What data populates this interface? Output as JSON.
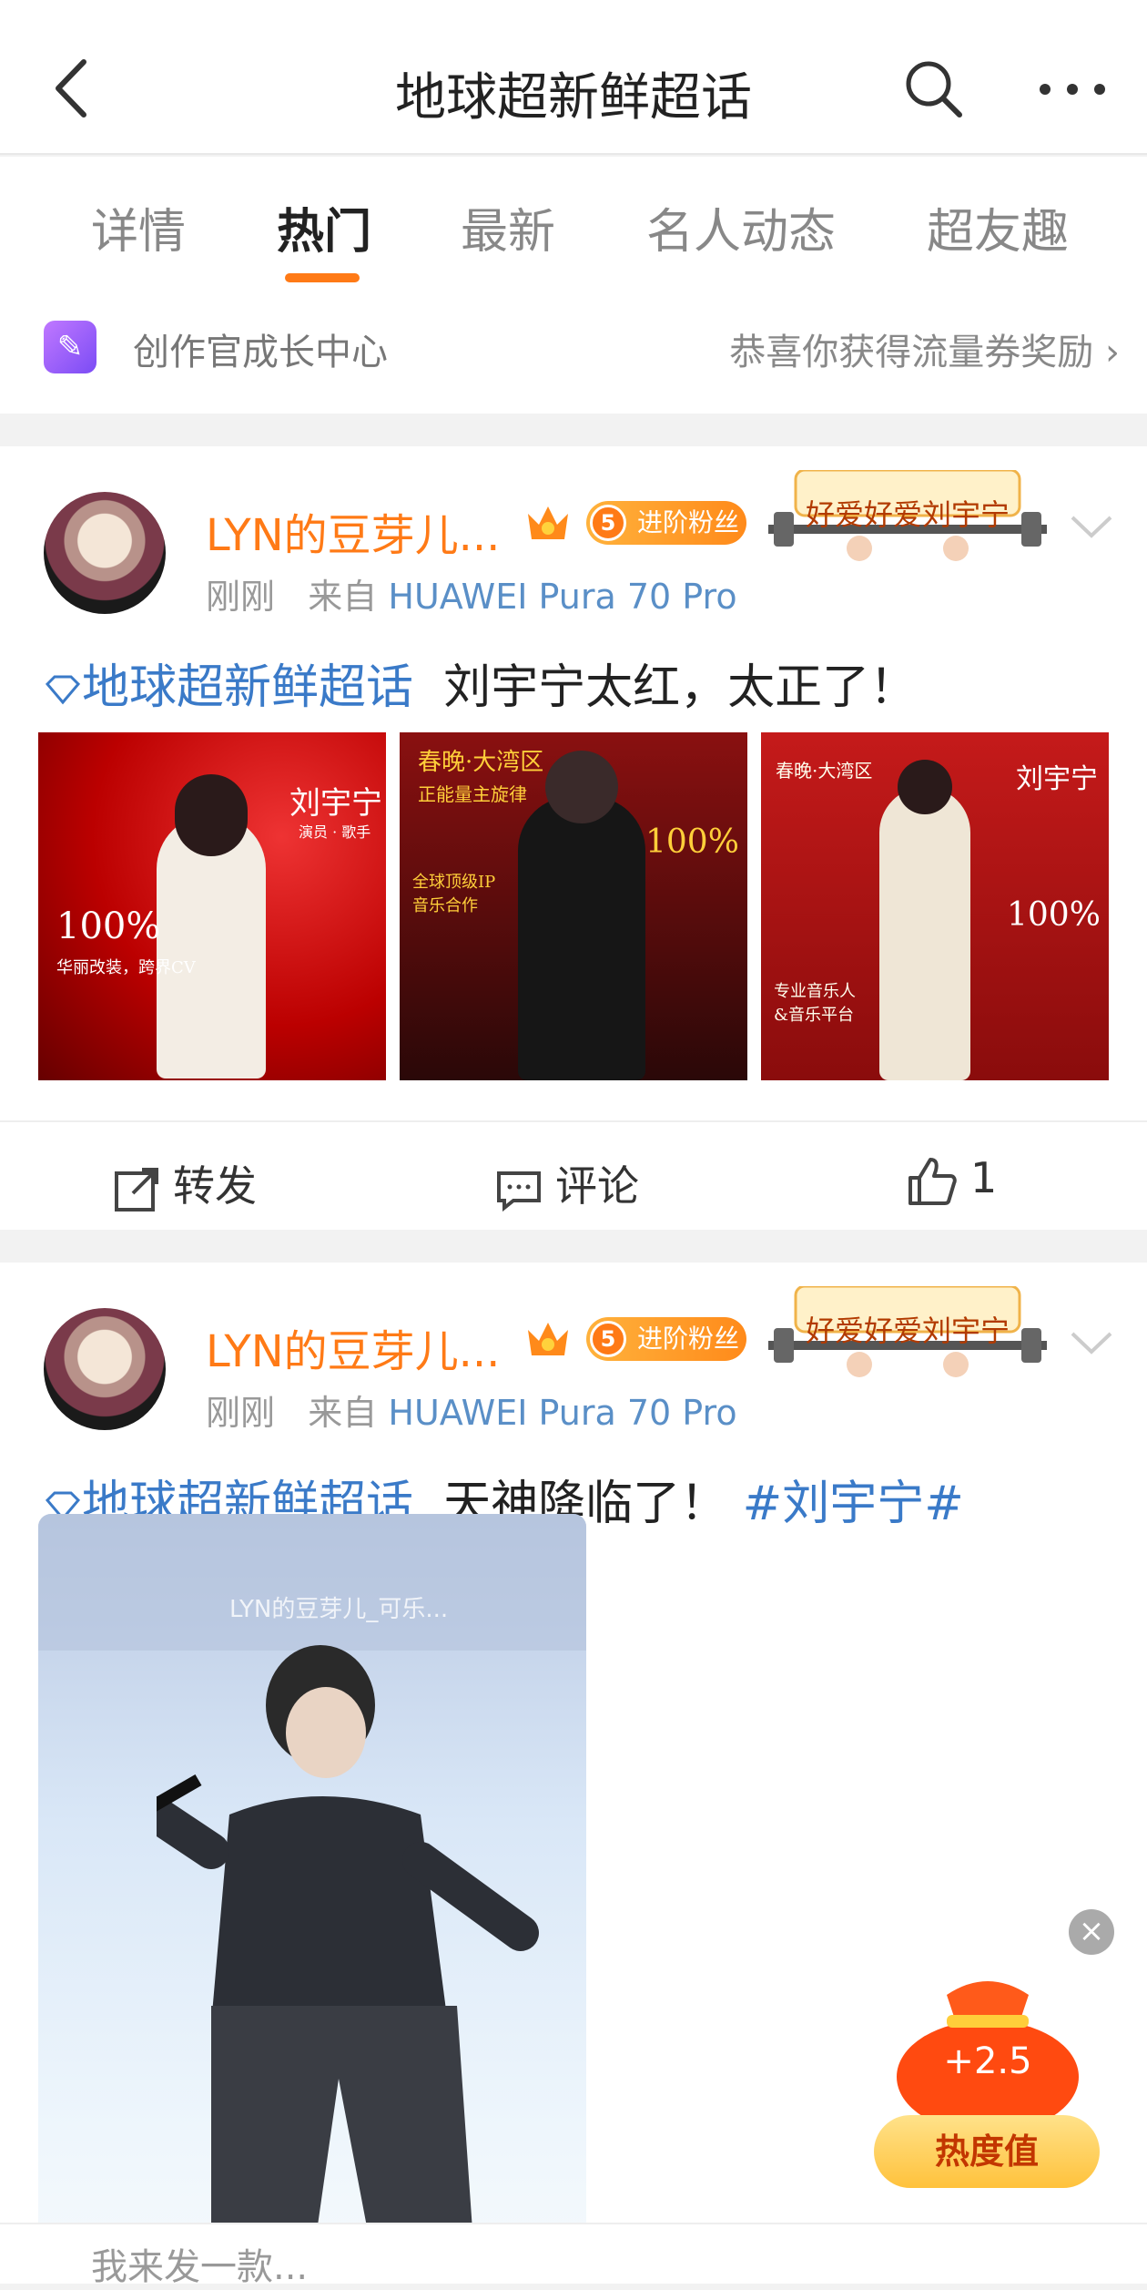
{
  "header": {
    "title": "地球超新鲜超话"
  },
  "tabs": [
    "详情",
    "热门",
    "最新",
    "名人动态",
    "超友趣"
  ],
  "active_tab": "热门",
  "creator_center": {
    "label": "创作官成长中心",
    "reward": "恭喜你获得流量券奖励 ›"
  },
  "posts": [
    {
      "username": "LYN的豆芽儿...",
      "fan_badge_level": "5",
      "fan_badge_text": "进阶粉丝",
      "banner_text": "好爱好爱刘宇宁",
      "time": "刚刚",
      "from_label": "来自",
      "device": "HUAWEI Pura 70 Pro",
      "topic": "地球超新鲜超话",
      "text": "刘宇宁太红，太正了！",
      "images": [
        {
          "title": "刘宇宁",
          "sub": "演员 · 歌手",
          "pct": "100%",
          "note": "华丽改装，跨界CV"
        },
        {
          "title": "春晚·大湾区",
          "sub": "正能量主旋律",
          "pct": "100%",
          "note": "全球顶级IP 音乐合作"
        },
        {
          "title": "刘宇宁",
          "sub": "春晚·大湾区",
          "pct": "100%",
          "note": "专业音乐人 &音乐平台"
        }
      ],
      "actions": {
        "repost": "转发",
        "comment": "评论",
        "like": "1"
      }
    },
    {
      "username": "LYN的豆芽儿...",
      "fan_badge_level": "5",
      "fan_badge_text": "进阶粉丝",
      "banner_text": "好爱好爱刘宇宁",
      "time": "刚刚",
      "from_label": "来自",
      "device": "HUAWEI Pura 70 Pro",
      "topic": "地球超新鲜超话",
      "text": "天神降临了！",
      "hashtag": "#刘宇宁#",
      "video_watermark": "LYN的豆芽儿_可乐..."
    }
  ],
  "reward_popup": {
    "value": "+2.5",
    "button": "热度值",
    "close": "×"
  },
  "bottom": {
    "comment_hint": "我来发一款..."
  }
}
